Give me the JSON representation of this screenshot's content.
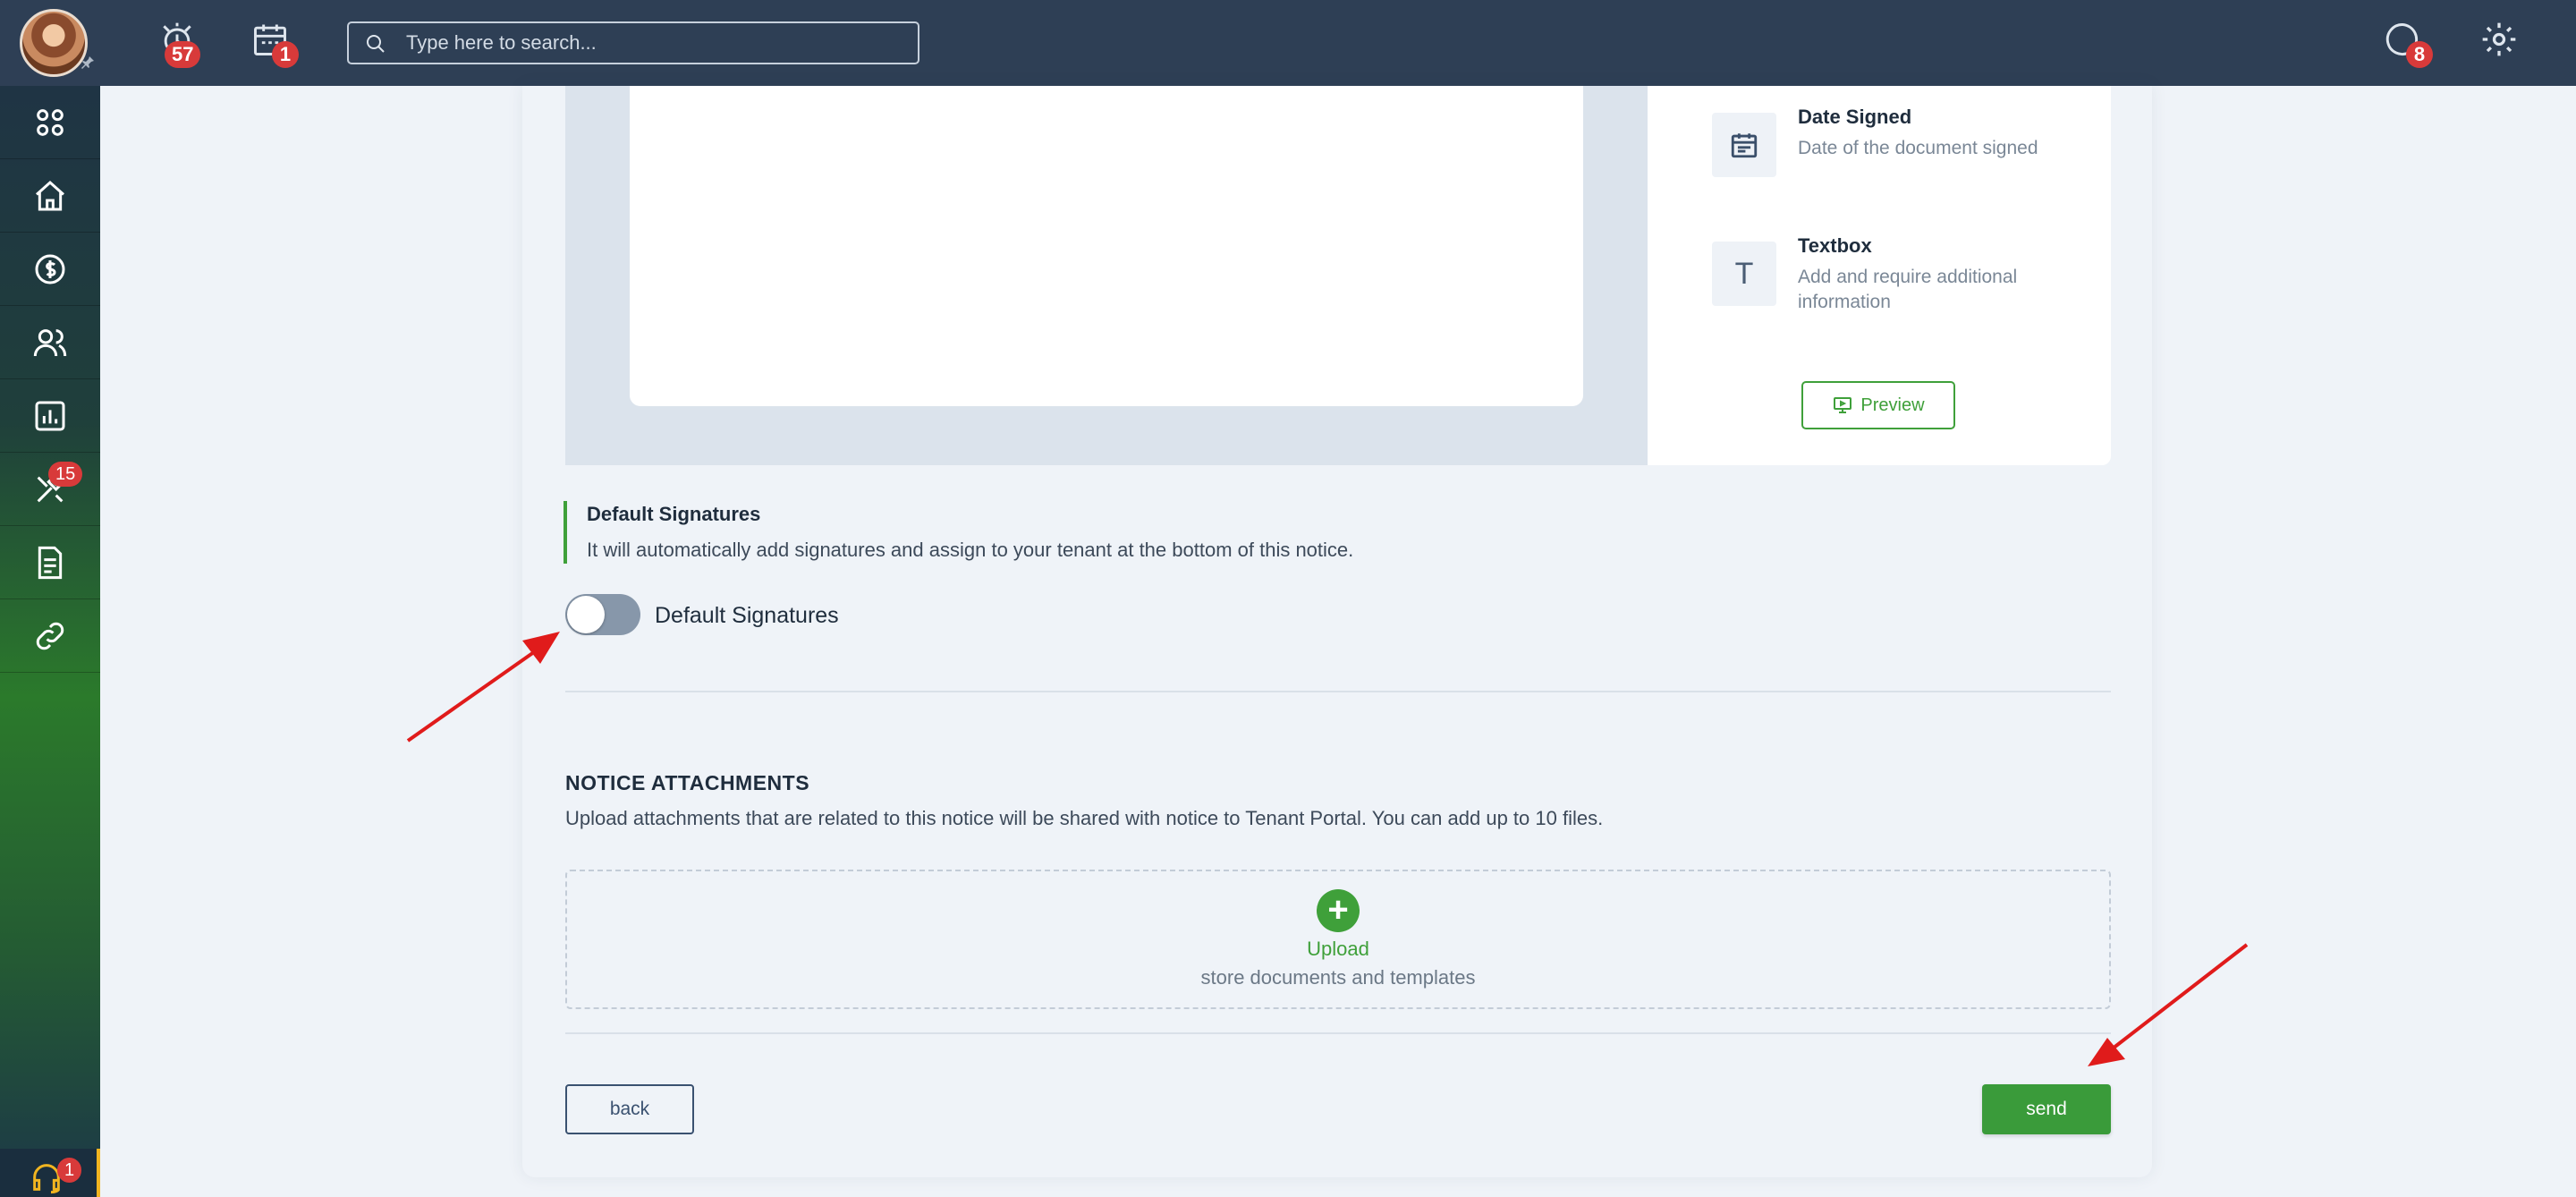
{
  "topbar": {
    "search_placeholder": "Type here to search...",
    "alarm_badge": "57",
    "calendar_badge": "1",
    "chat_badge": "8"
  },
  "sidebar": {
    "items": [
      {
        "icon": "grid-icon"
      },
      {
        "icon": "home-icon"
      },
      {
        "icon": "dollar-icon"
      },
      {
        "icon": "users-icon"
      },
      {
        "icon": "chart-icon"
      },
      {
        "icon": "tools-icon",
        "badge": "15"
      },
      {
        "icon": "document-icon"
      },
      {
        "icon": "link-icon"
      }
    ],
    "support_badge": "1"
  },
  "fields": [
    {
      "icon": "calendar-icon",
      "title": "Date Signed",
      "desc": "Date of the document signed"
    },
    {
      "icon": "textbox-icon",
      "glyph": "T",
      "title": "Textbox",
      "desc": "Add and require additional information"
    }
  ],
  "preview_label": "Preview",
  "default_signatures": {
    "title": "Default Signatures",
    "desc": "It will automatically add signatures and assign to your tenant at the bottom of this notice.",
    "toggle_label": "Default Signatures",
    "enabled": false
  },
  "attachments": {
    "title": "NOTICE ATTACHMENTS",
    "desc": "Upload attachments that are related to this notice will be shared with notice to Tenant Portal. You can add up to 10 files.",
    "upload_label": "Upload",
    "upload_sub": "store documents and templates"
  },
  "buttons": {
    "back": "back",
    "send": "send"
  },
  "colors": {
    "topbar": "#2e3f55",
    "accent_green": "#3fa03a",
    "badge_red": "#d83a3a",
    "annotation_red": "#e01b1b"
  }
}
